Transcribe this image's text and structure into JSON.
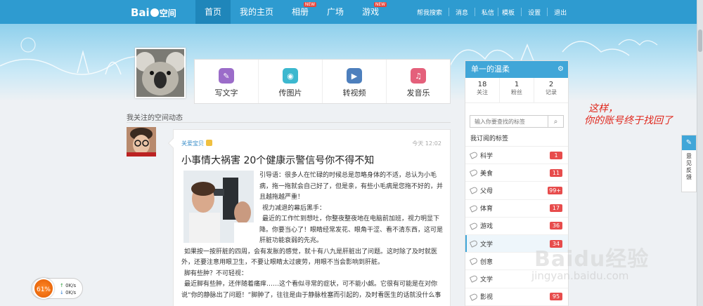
{
  "topbar": {
    "logo_text": "Bai",
    "logo_sub": "空间",
    "nav": [
      {
        "label": "首页",
        "active": true,
        "badge": ""
      },
      {
        "label": "我的主页",
        "active": false,
        "badge": ""
      },
      {
        "label": "相册",
        "active": false,
        "badge": "NEW"
      },
      {
        "label": "广场",
        "active": false,
        "badge": ""
      },
      {
        "label": "游戏",
        "active": false,
        "badge": "NEW"
      }
    ],
    "right_links": [
      "帮我搜索",
      "消息",
      "私信",
      "模板",
      "设置",
      "退出"
    ]
  },
  "actions": [
    {
      "label": "写文字",
      "icon": "pencil-icon",
      "color": "#9b6cc9"
    },
    {
      "label": "传图片",
      "icon": "camera-icon",
      "color": "#3cb8cf"
    },
    {
      "label": "转视频",
      "icon": "play-icon",
      "color": "#4d7fbd"
    },
    {
      "label": "发音乐",
      "icon": "music-icon",
      "color": "#e4607b"
    }
  ],
  "feed": {
    "section_title": "我关注的空间动态",
    "post": {
      "author": "关爱宝贝",
      "time": "今天 12:02",
      "title": "小事情大祸害 20个健康示警信号你不得不知",
      "paragraphs": [
        "引导语：很多人在忙碌的时候总是忽略身体的不适，总认为小毛病，拖一拖就会自己好了，但是亲，有些小毛病是您拖不好的，并且越拖越严重！",
        "视力减退的幕后黑手：",
        "最近的工作忙到想吐，你整夜整夜地在电脑前加班，视力明显下降。你要当心了！眼睛经常发花、眼角干涩、看不清东西，这可是肝脏功能衰弱的先兆。",
        "如果按一按肝脏的四周，会有发胀的感觉，就十有八九是肝脏出了问题。这时除了及时就医外，还要注意用眼卫生，不要让眼睛太过疲劳，用眼不当会影响到肝脏。",
        "脚有些肿？不可轻视：",
        "最近脚有些肿，还伴随着痛痒……这个看似寻常的症状，可不能小觑。它很有可能是在对你说“你的静脉出了问题！”脚肿了，往往是由于静脉栓塞而引起的，及时看医生的话就没什么事"
      ]
    }
  },
  "sidebar": {
    "title": "单一的温柔",
    "stats": [
      {
        "num": "18",
        "label": "关注"
      },
      {
        "num": "1",
        "label": "粉丝"
      },
      {
        "num": "2",
        "label": "记录"
      }
    ],
    "search_placeholder": "输入你要查找的标签",
    "tags_title": "我订阅的标签",
    "tags": [
      {
        "name": "科学",
        "count": "1"
      },
      {
        "name": "美食",
        "count": "11"
      },
      {
        "name": "父母",
        "count": "99+"
      },
      {
        "name": "体育",
        "count": "17"
      },
      {
        "name": "游戏",
        "count": "36"
      },
      {
        "name": "文学",
        "count": "34"
      },
      {
        "name": "创意",
        "count": ""
      },
      {
        "name": "文学",
        "count": ""
      },
      {
        "name": "影视",
        "count": "95"
      }
    ]
  },
  "annotation": {
    "line1": "这样，",
    "line2": "你的账号终于找回了"
  },
  "feedback": {
    "label": "意见反馈"
  },
  "watermark": {
    "main": "Baidu经验",
    "sub": "jingyan.baidu.com"
  },
  "speed": {
    "percent": "61%",
    "up": "0K/s",
    "down": "0K/s"
  }
}
